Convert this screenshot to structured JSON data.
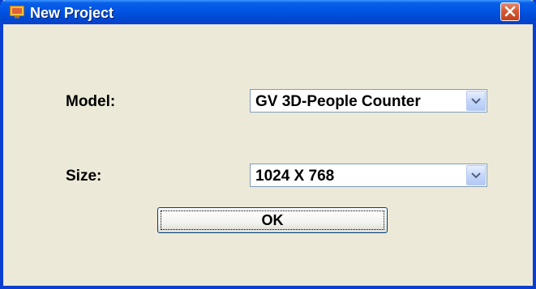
{
  "window": {
    "title": "New Project",
    "icon": "app-icon",
    "close_icon": "close-icon"
  },
  "form": {
    "model_label": "Model:",
    "model_value": "GV 3D-People Counter",
    "size_label": "Size:",
    "size_value": "1024 X 768"
  },
  "buttons": {
    "ok_label": "OK"
  },
  "colors": {
    "titlebar": "#0054e3",
    "window_border": "#0a3fd0",
    "dialog_background": "#ece9d8",
    "close_button": "#d45a36"
  }
}
